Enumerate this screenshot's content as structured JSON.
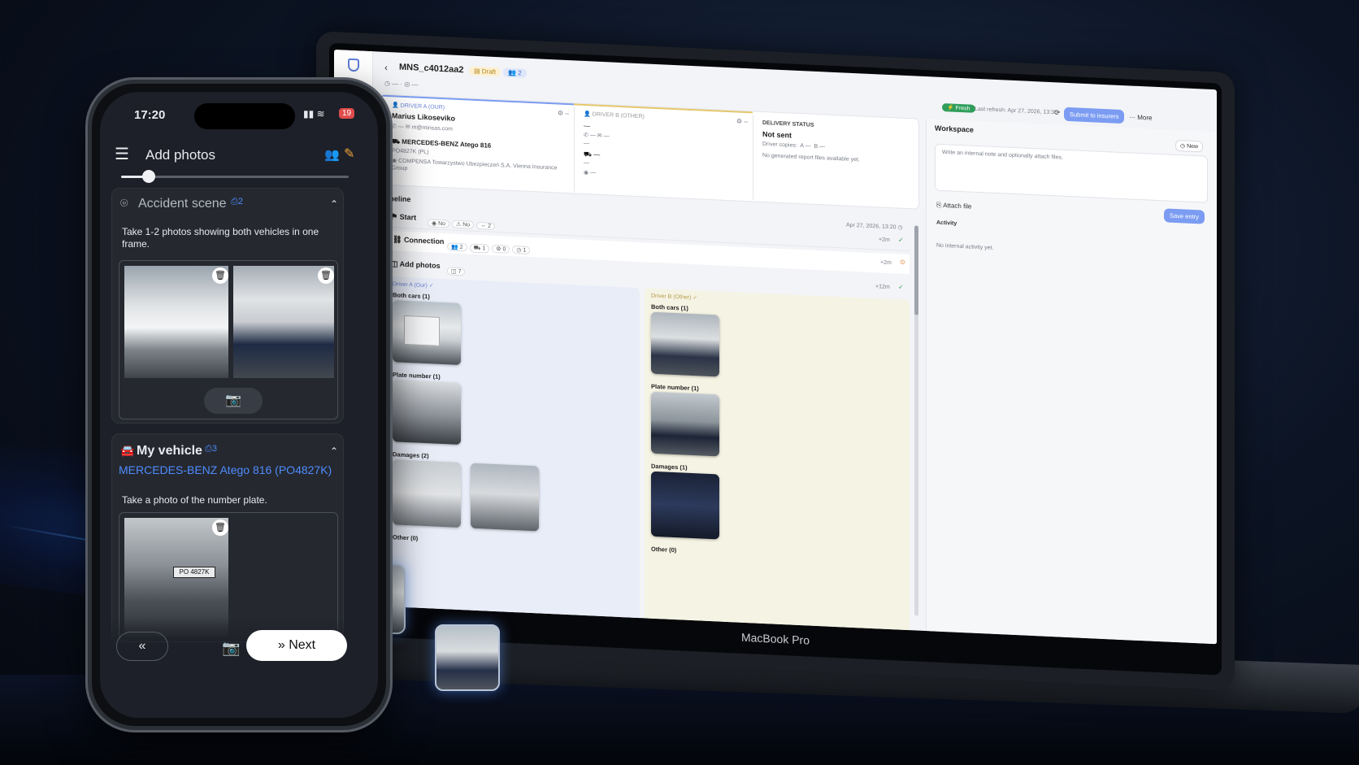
{
  "laptop": {
    "brand": "MacBook Pro",
    "header": {
      "case_id": "MNS_c4012aa2",
      "status_badge": "Draft",
      "participants_badge": "2",
      "meta_1": "—",
      "meta_2": "—",
      "fresh_badge": "Fresh",
      "last_refresh": "Last refresh: Apr 27, 2026, 13:35",
      "submit_button": "Submit to insurers",
      "more_button": "More"
    },
    "driver_a": {
      "label": "DRIVER A (OUR)",
      "name": "Marius Likoseviko",
      "phone": "—",
      "email": "m@minsas.com",
      "vehicle": "MERCEDES-BENZ Atego 816",
      "plate": "PO4827K (PL)",
      "insurer": "COMPENSA Towarzystwo Ubezpieczeń S.A. Vienna Insurance Group"
    },
    "driver_b": {
      "label": "DRIVER B (OTHER)",
      "name": "—",
      "phone": "—",
      "email": "—",
      "line4": "—",
      "vehicle": "—",
      "plate": "—",
      "insurer": "—"
    },
    "delivery": {
      "label": "DELIVERY STATUS",
      "value": "Not sent",
      "copies_label": "Driver copies:",
      "copies_a": "A —",
      "copies_b": "B —",
      "files_note": "No generated report files available yet."
    },
    "timeline": {
      "title": "Timeline",
      "date": "Apr 27, 2026, 13:20",
      "items": [
        {
          "label": "Start",
          "tags": [
            "No",
            "No",
            "2"
          ],
          "delta": "+2m"
        },
        {
          "label": "Connection",
          "tags": [
            "2",
            "1",
            "0",
            "1"
          ],
          "delta": "+2m"
        },
        {
          "label": "Add photos",
          "tags": [
            "7"
          ],
          "delta": "+12m"
        }
      ]
    },
    "photos": {
      "driver_a_label": "Driver A (Our)",
      "driver_b_label": "Driver B (Other)",
      "a_sections": [
        "Both cars (1)",
        "Plate number (1)",
        "Damages (2)",
        "Other (0)"
      ],
      "b_sections": [
        "Both cars (1)",
        "Plate number (1)",
        "Damages (1)",
        "Other (0)"
      ]
    },
    "workspace": {
      "title": "Workspace",
      "new_button": "New",
      "note_placeholder": "Write an internal note and optionally attach files.",
      "attach_label": "Attach file",
      "save_button": "Save entry",
      "activity_label": "Activity",
      "activity_empty": "No internal activity yet."
    }
  },
  "phone": {
    "time": "17:20",
    "battery": "19",
    "title": "Add photos",
    "progress": 0.12,
    "accident": {
      "title": "Accident scene",
      "count": "2",
      "instruction": "Take 1-2 photos showing both vehicles in one frame."
    },
    "vehicle": {
      "title": "My vehicle",
      "count": "3",
      "name": "MERCEDES-BENZ Atego 816 (PO4827K)",
      "instruction": "Take a photo of the number plate.",
      "plate_text": "PO 4827K"
    },
    "back_button": "«",
    "next_button": "Next"
  },
  "colors": {
    "accent": "#7b9cf2",
    "driver_a_bg": "#e9edf8",
    "driver_b_bg": "#f5f3e3",
    "phone_link": "#4e8cff"
  }
}
